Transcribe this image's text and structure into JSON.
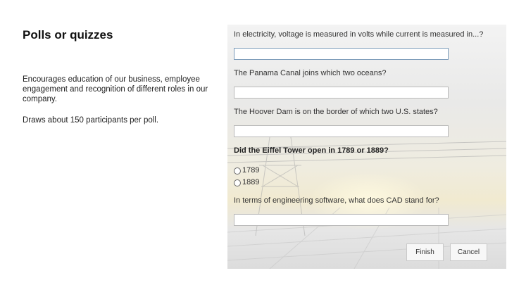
{
  "slide": {
    "title": "Polls or quizzes",
    "description": "Encourages education of our business, employee engagement and recognition of different roles in our company.",
    "participation": "Draws about 150 participants per poll."
  },
  "quiz": {
    "q1": "In electricity, voltage is measured in volts while current is measured in...?",
    "q2": "The Panama Canal joins which two oceans?",
    "q3": "The Hoover Dam is on the border of which two U.S. states?",
    "q4": "Did the Eiffel Tower open in 1789 or 1889?",
    "q4_options": [
      "1789",
      "1889"
    ],
    "q5": "In terms of engineering software, what does CAD stand for?",
    "finish_label": "Finish",
    "cancel_label": "Cancel"
  }
}
